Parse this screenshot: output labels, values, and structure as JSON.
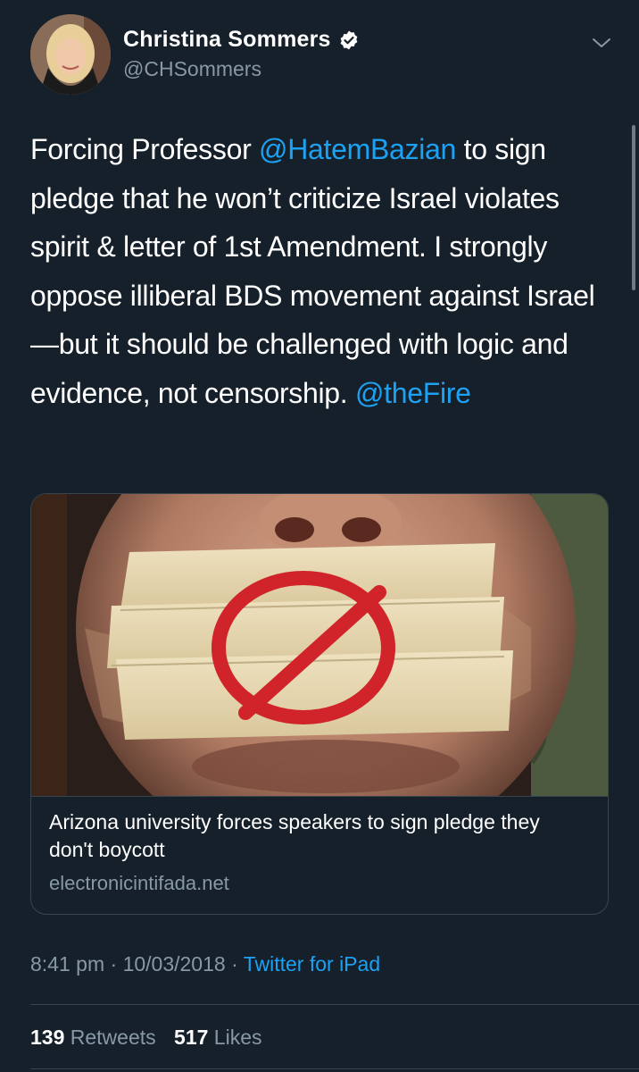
{
  "author": {
    "name": "Christina Sommers",
    "handle": "@CHSommers",
    "verified_icon": "verified-badge-icon",
    "menu_icon": "chevron-down-icon"
  },
  "tweet": {
    "parts": [
      {
        "text": "Forcing Professor ",
        "type": "text"
      },
      {
        "text": "@HatemBazian",
        "type": "mention"
      },
      {
        "text": " to sign pledge that he won’t criticize Israel violates spirit & letter of 1st Amendment. I strongly oppose illiberal BDS movement against Israel—but it should be challenged with logic and evidence, not censorship. ",
        "type": "text"
      },
      {
        "text": "@theFire",
        "type": "mention"
      }
    ]
  },
  "card": {
    "title": "Arizona university forces speakers to sign pledge they don't boycott",
    "domain": "electronicintifada.net"
  },
  "meta": {
    "time": "8:41 pm",
    "separator": " · ",
    "date": "10/03/2018",
    "source": "Twitter for iPad"
  },
  "stats": {
    "retweets_count": "139",
    "retweets_label": "Retweets",
    "likes_count": "517",
    "likes_label": "Likes"
  },
  "colors": {
    "background": "#15202b",
    "accent": "#1da1f2",
    "secondary_text": "#8899a6",
    "border": "#38444d"
  }
}
